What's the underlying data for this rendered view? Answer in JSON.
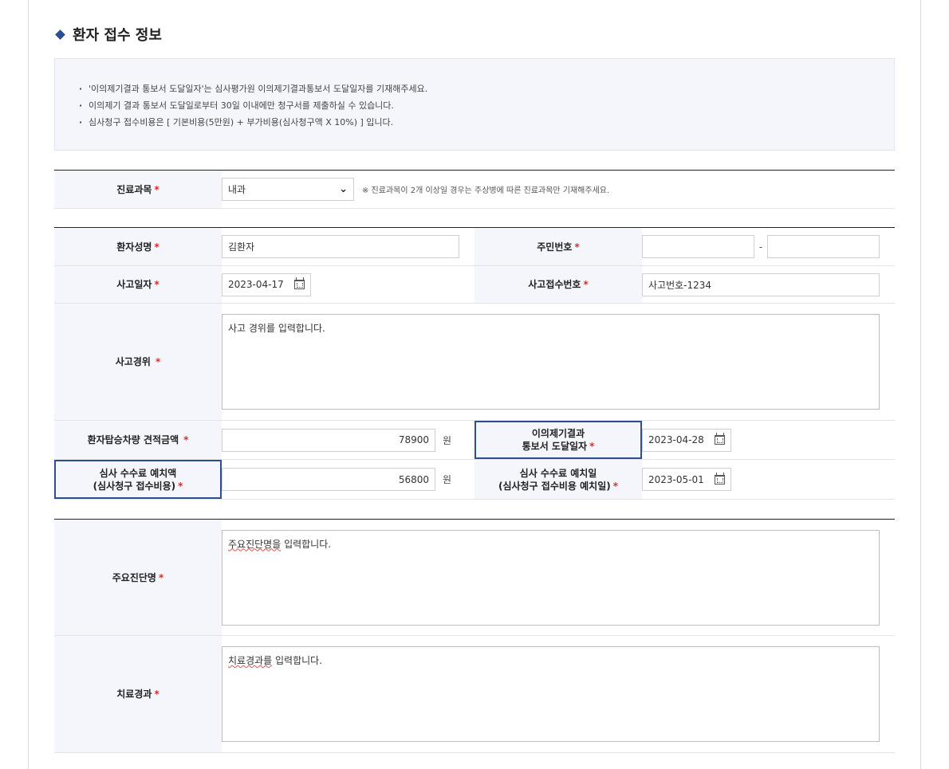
{
  "section": {
    "title": "환자 접수 정보"
  },
  "notice": {
    "items": [
      "'이의제기결과 통보서 도달일자'는 심사평가원 이의제기결과통보서 도달일자를 기재해주세요.",
      "이의제기 결과 통보서 도달일로부터 30일 이내에만 청구서를 제출하실 수 있습니다.",
      "심사청구 접수비용은 [ 기본비용(5만원) + 부가비용(심사청구액 X 10%) ] 입니다."
    ]
  },
  "required_mark": "*",
  "department": {
    "label": "진료과목",
    "selected": "내과",
    "hint": "※ 진료과목이 2개 이상일 경우는 주상병에 따른 진료과목만 기재해주세요."
  },
  "patient": {
    "name_label": "환자성명",
    "name_value": "김환자",
    "rrn_label": "주민번호",
    "rrn_front": "",
    "rrn_back": "",
    "rrn_separator": "-",
    "accident_date_label": "사고일자",
    "accident_date_value": "2023-04-17",
    "accident_no_label": "사고접수번호",
    "accident_no_value": "사고번호-1234",
    "accident_desc_label": "사고경위",
    "accident_desc_value": "사고 경위를 입력합니다.",
    "vehicle_estimate_label": "환자탑승차량 견적금액",
    "vehicle_estimate_value": "78900",
    "currency_unit": "원",
    "objection_date_label_1": "이의제기결과",
    "objection_date_label_2": "통보서 도달일자",
    "objection_date_value": "2023-04-28",
    "fee_amount_label_1": "심사 수수료 예치액",
    "fee_amount_label_2": "(심사청구 접수비용)",
    "fee_amount_value": "56800",
    "fee_date_label_1": "심사 수수료 예치일",
    "fee_date_label_2": "(심사청구 접수비용 예치일)",
    "fee_date_value": "2023-05-01"
  },
  "diagnosis": {
    "main_label": "주요진단명",
    "main_value_underlined": "주요진단명을",
    "main_value_rest": " 입력합니다.",
    "treatment_label": "치료경과",
    "treatment_value_underlined": "치료경과를",
    "treatment_value_rest": " 입력합니다."
  },
  "colors": {
    "accent": "#2d4e91",
    "required": "#d32f2f",
    "label_bg": "#f4f6fb"
  },
  "icons": [
    "diamond-bullet-icon",
    "chevron-down-icon",
    "calendar-icon"
  ]
}
